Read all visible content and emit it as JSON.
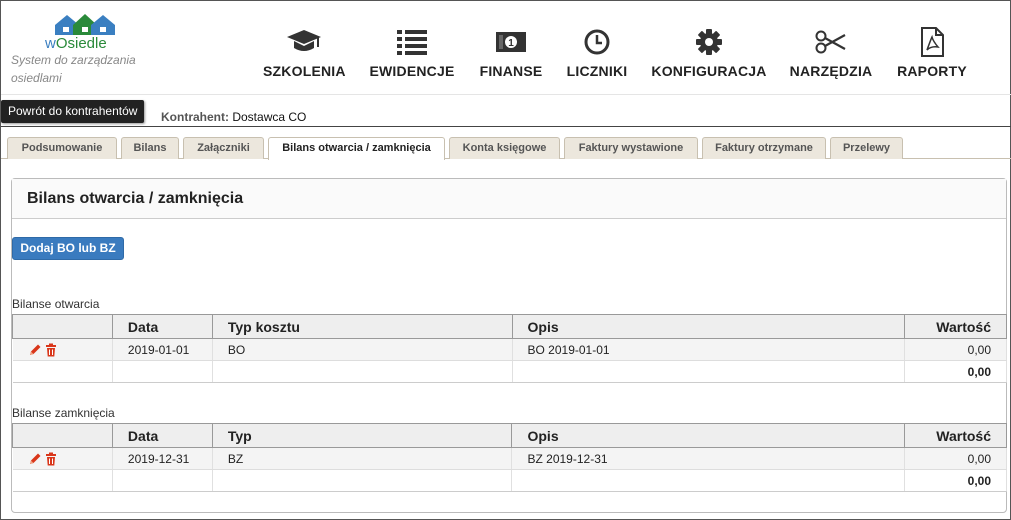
{
  "logo": {
    "name_w": "w",
    "name_rest": "Osiedle",
    "tagline": "System do zarządzania osiedlami"
  },
  "nav": [
    {
      "label": "SZKOLENIA",
      "icon": "graduation-cap-icon"
    },
    {
      "label": "EWIDENCJE",
      "icon": "list-icon"
    },
    {
      "label": "FINANSE",
      "icon": "money-icon"
    },
    {
      "label": "LICZNIKI",
      "icon": "clock-icon"
    },
    {
      "label": "KONFIGURACJA",
      "icon": "gear-icon"
    },
    {
      "label": "NARZĘDZIA",
      "icon": "scissors-icon"
    },
    {
      "label": "RAPORTY",
      "icon": "pdf-file-icon"
    }
  ],
  "topbar": {
    "back_label": "Powrót do kontrahentów",
    "contractor_label": "Kontrahent:",
    "contractor_value": "Dostawca CO"
  },
  "tabs": [
    {
      "label": "Podsumowanie"
    },
    {
      "label": "Bilans"
    },
    {
      "label": "Załączniki"
    },
    {
      "label": "Bilans otwarcia / zamknięcia",
      "active": true
    },
    {
      "label": "Konta księgowe"
    },
    {
      "label": "Faktury wystawione"
    },
    {
      "label": "Faktury otrzymane"
    },
    {
      "label": "Przelewy"
    }
  ],
  "panel": {
    "title": "Bilans otwarcia / zamknięcia",
    "add_label": "Dodaj BO lub BZ",
    "opening": {
      "title": "Bilanse otwarcia",
      "headers": {
        "c1": "",
        "c2": "Data",
        "c3": "Typ kosztu",
        "c4": "Opis",
        "c5": "Wartość"
      },
      "rows": [
        {
          "data": "2019-01-01",
          "typ": "BO",
          "opis": "BO 2019-01-01",
          "wartosc": "0,00"
        }
      ],
      "total": "0,00"
    },
    "closing": {
      "title": "Bilanse zamknięcia",
      "headers": {
        "c1": "",
        "c2": "Data",
        "c3": "Typ",
        "c4": "Opis",
        "c5": "Wartość"
      },
      "rows": [
        {
          "data": "2019-12-31",
          "typ": "BZ",
          "opis": "BZ 2019-12-31",
          "wartosc": "0,00"
        }
      ],
      "total": "0,00"
    }
  },
  "colors": {
    "accent": "#3a7bbf",
    "action_icon": "#d9361a",
    "logo_green": "#2a8a3a",
    "logo_blue": "#3a7fc1"
  }
}
